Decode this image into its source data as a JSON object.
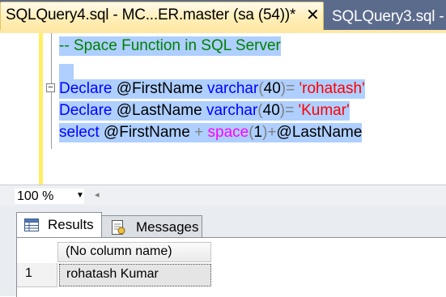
{
  "tabs": {
    "active": {
      "title": "SQLQuery4.sql - MC...ER.master (sa (54))*",
      "close_glyph": "✕"
    },
    "inactive": {
      "title": "SQLQuery3.sql - "
    }
  },
  "editor": {
    "comment": "-- Space Function in SQL Server",
    "line1": {
      "kw": "Declare",
      "var": "@FirstName",
      "type": "varchar",
      "open": "(",
      "len": "40",
      "close": ")",
      "eq": "=",
      "str": "'rohatash'"
    },
    "line2": {
      "kw": "Declare",
      "var": "@LastName",
      "type": "varchar",
      "open": "(",
      "len": "40",
      "close": ")",
      "eq": "=",
      "str": "'Kumar'"
    },
    "line3": {
      "kw": "select",
      "var1": "@FirstName",
      "plus1": "+",
      "fn": "space",
      "open": "(",
      "arg": "1",
      "close": ")",
      "plus2": "+",
      "var2": "@LastName"
    },
    "collapse_glyph": "−"
  },
  "zoom": {
    "value": "100 %",
    "arrow": "▼",
    "scroll_left_glyph": "◂"
  },
  "results": {
    "tabs": {
      "results": "Results",
      "messages": "Messages"
    },
    "column_header": "(No column name)",
    "rows": [
      {
        "num": "1",
        "value": "rohatash Kumar"
      }
    ]
  },
  "colors": {
    "keyword": "#0000ff",
    "string": "#ff0000",
    "function": "#ff00ff",
    "comment": "#008000",
    "operator": "#808080",
    "selection": "#aecfff",
    "tab_active": "#ffe8a6",
    "tab_strip": "#5b6b8c"
  },
  "icons": [
    "close-icon",
    "collapse-icon",
    "dropdown-arrow-icon",
    "scroll-left-icon",
    "results-grid-icon",
    "messages-icon"
  ]
}
